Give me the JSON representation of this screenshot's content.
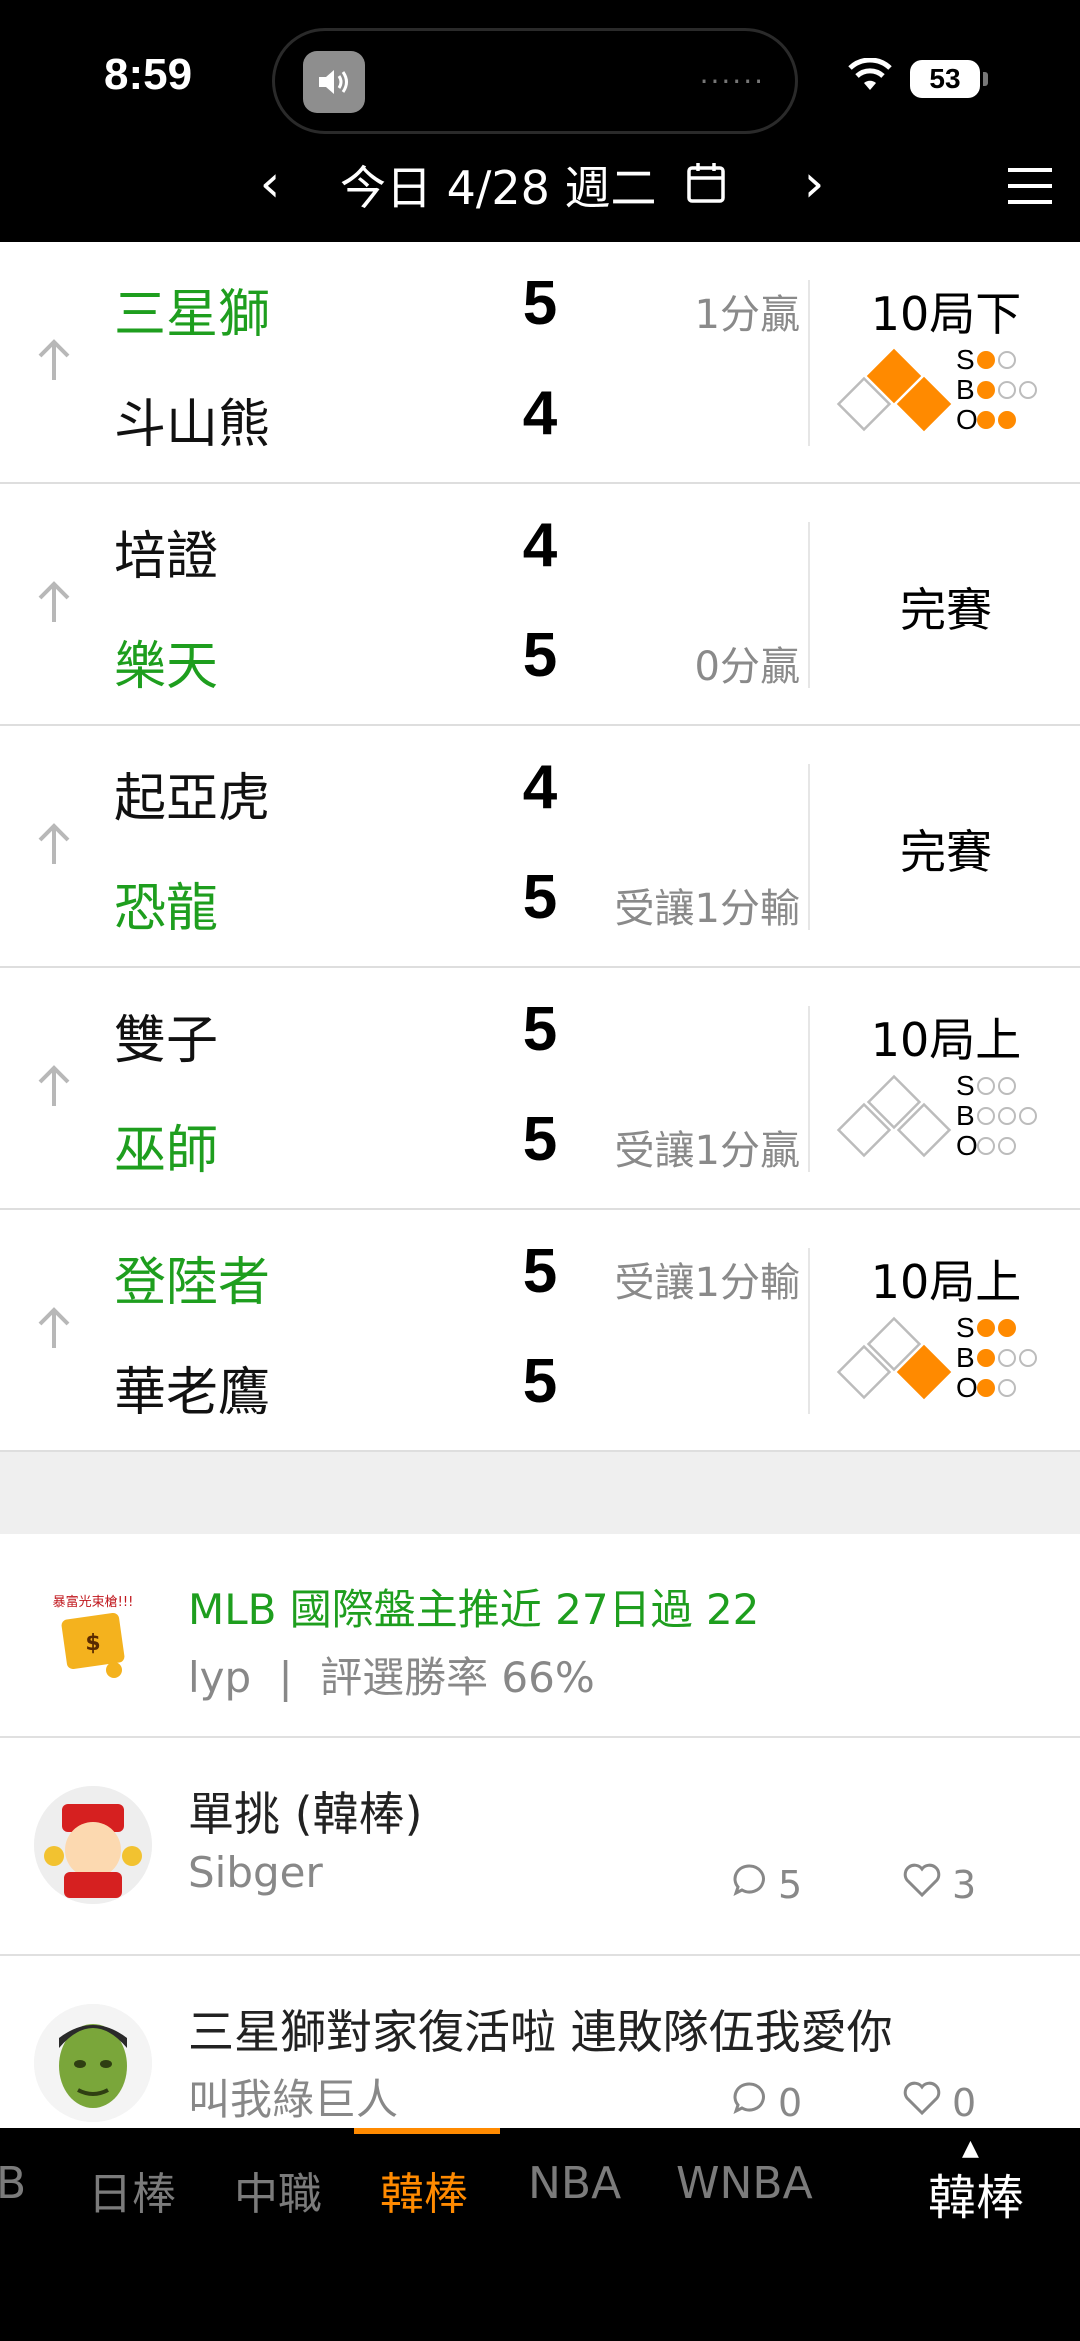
{
  "status_bar": {
    "time": "8:59",
    "dots": "······",
    "battery": "53"
  },
  "date_header": {
    "prev": "‹",
    "next": "›",
    "date": "今日 4/28 週二"
  },
  "games": [
    {
      "team1": "三星獅",
      "team1_win": true,
      "score1": "5",
      "note1": "1分贏",
      "team2": "斗山熊",
      "team2_win": false,
      "score2": "4",
      "note2": "",
      "status": "10局下",
      "live": true,
      "bases": {
        "second": true,
        "third": false,
        "first": true
      },
      "count": {
        "S": 1,
        "B": 1,
        "O": 2
      }
    },
    {
      "team1": "培證",
      "team1_win": false,
      "score1": "4",
      "note1": "",
      "team2": "樂天",
      "team2_win": true,
      "score2": "5",
      "note2": "0分贏",
      "status": "完賽",
      "live": false
    },
    {
      "team1": "起亞虎",
      "team1_win": false,
      "score1": "4",
      "note1": "",
      "team2": "恐龍",
      "team2_win": true,
      "score2": "5",
      "note2": "受讓1分輸",
      "status": "完賽",
      "live": false
    },
    {
      "team1": "雙子",
      "team1_win": false,
      "score1": "5",
      "note1": "",
      "team2": "巫師",
      "team2_win": true,
      "score2": "5",
      "note2": "受讓1分贏",
      "status": "10局上",
      "live": true,
      "bases": {
        "second": false,
        "third": false,
        "first": false
      },
      "count": {
        "S": 0,
        "B": 0,
        "O": 0
      }
    },
    {
      "team1": "登陸者",
      "team1_win": true,
      "score1": "5",
      "note1": "受讓1分輸",
      "team2": "華老鷹",
      "team2_win": false,
      "score2": "5",
      "note2": "",
      "status": "10局上",
      "live": true,
      "bases": {
        "second": false,
        "third": false,
        "first": true
      },
      "count": {
        "S": 2,
        "B": 1,
        "O": 1
      }
    }
  ],
  "posts": [
    {
      "title": "MLB 國際盤主推近 27日過 22",
      "author": "lyp",
      "separator": "|",
      "meta": "評選勝率 66%",
      "avatar_text": "暴富光束槍!!!"
    },
    {
      "title": "單挑 (韓棒)",
      "author": "Sibger",
      "comments": "5",
      "likes": "3"
    },
    {
      "title": "三星獅對家復活啦 連敗隊伍我愛你",
      "author": "叫我綠巨人",
      "comments": "0",
      "likes": "0"
    }
  ],
  "league_tabs": [
    "B",
    "日棒",
    "中職",
    "韓棒",
    "NBA",
    "WNBA"
  ],
  "league_active": "韓棒",
  "league_current": {
    "caret": "▲",
    "label": "韓棒"
  },
  "colors": {
    "accent": "#ff8a00",
    "win_green": "#1e9e1e"
  },
  "icons": [
    "speaker-icon",
    "wifi-icon",
    "calendar-icon",
    "menu-icon",
    "arrow-up-icon",
    "comment-icon",
    "heart-icon"
  ]
}
